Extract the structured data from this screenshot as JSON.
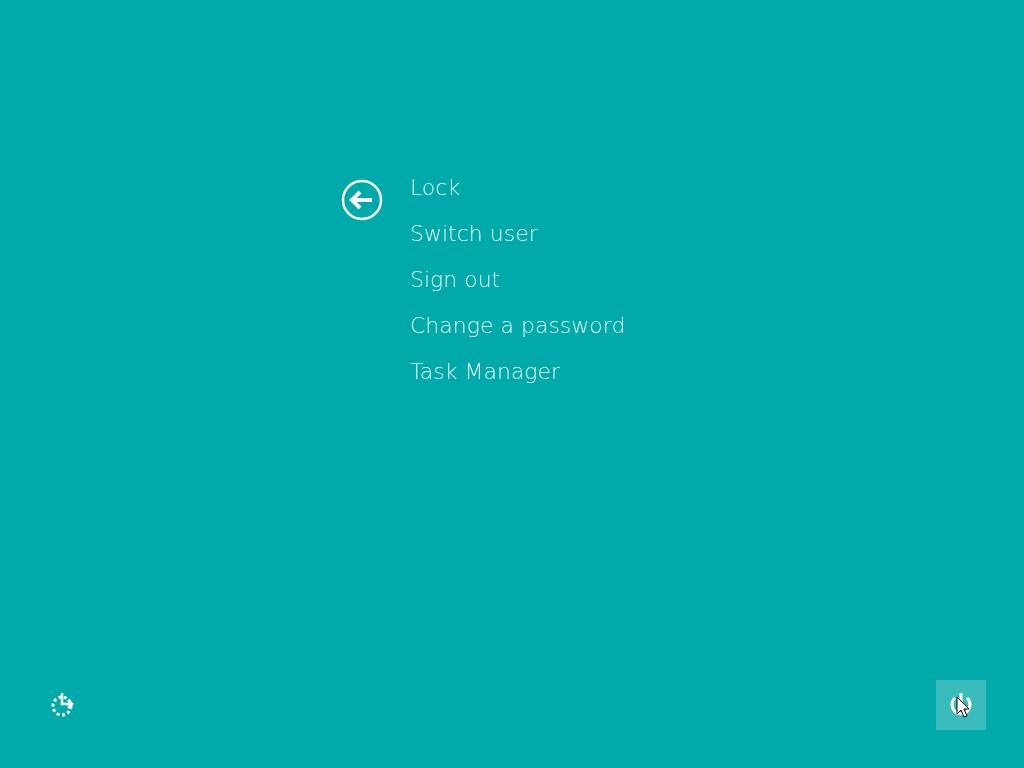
{
  "menu": {
    "items": [
      {
        "label": "Lock"
      },
      {
        "label": "Switch user"
      },
      {
        "label": "Sign out"
      },
      {
        "label": "Change a password"
      },
      {
        "label": "Task Manager"
      }
    ]
  },
  "power_button": {
    "hovered": true
  }
}
